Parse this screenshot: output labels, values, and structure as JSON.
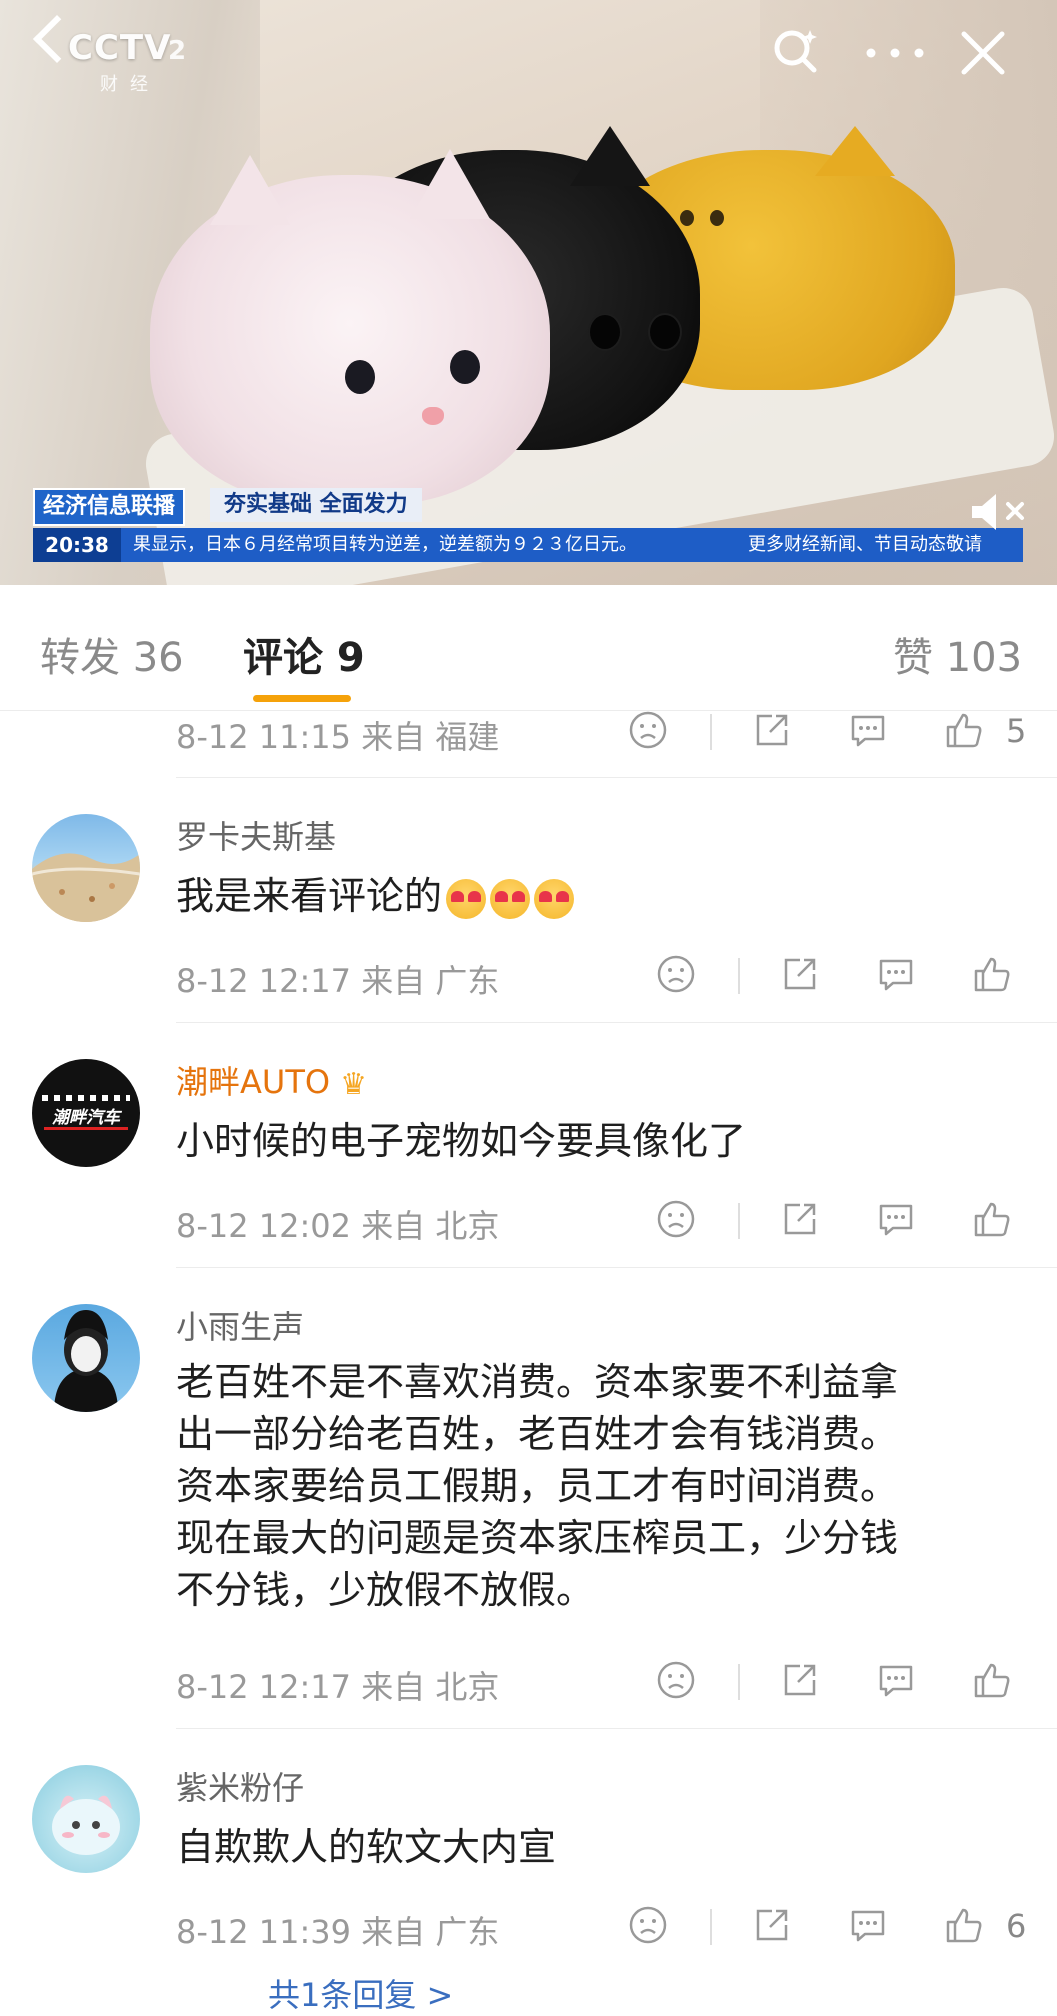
{
  "video": {
    "logo": "CCTV",
    "logo_channel": "2",
    "logo_sub": "财经",
    "ticker_tag": "经济信息联播",
    "ticker_title": "夯实基础 全面发力",
    "ticker_time": "20:38",
    "ticker_text": "果显示，日本６月经常项目转为逆差，逆差额为９２３亿日元。",
    "ticker_more": "更多财经新闻、节目动态敬请"
  },
  "tabs": {
    "repost": "转发 36",
    "comments": "评论 9",
    "likes": "赞 103"
  },
  "comments": [
    {
      "meta": "8-12 11:15  来自 福建",
      "like_count": "5"
    },
    {
      "username": "罗卡夫斯基",
      "content": "我是来看评论的",
      "meta": "8-12 12:17  来自 广东",
      "like_count": ""
    },
    {
      "username": "潮畔AUTO",
      "avatar_text": "潮畔汽车",
      "content": "小时候的电子宠物如今要具像化了",
      "meta": "8-12 12:02  来自 北京",
      "like_count": ""
    },
    {
      "username": "小雨生声",
      "content_lines": [
        "老百姓不是不喜欢消费。资本家要不利益拿",
        "出一部分给老百姓，老百姓才会有钱消费。",
        "资本家要给员工假期，员工才有时间消费。",
        "现在最大的问题是资本家压榨员工，少分钱",
        "不分钱，少放假不放假。"
      ],
      "meta": "8-12 12:17  来自 北京",
      "like_count": ""
    },
    {
      "username": "紫米粉仔",
      "content": "自欺欺人的软文大内宣",
      "meta": "8-12 11:39  来自 广东",
      "like_count": "6"
    }
  ],
  "reply_link": "共1条回复 >",
  "colors": {
    "tab_underline": "#f5a20a",
    "vip_name": "#e5740d",
    "ticker_blue": "#1e5dc6"
  }
}
